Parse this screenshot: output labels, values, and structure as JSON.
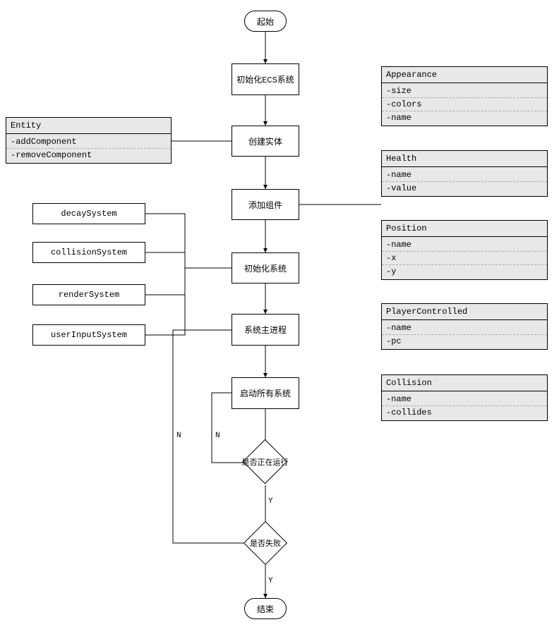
{
  "flow": {
    "start": "起始",
    "init_ecs": "初始化ECS系统",
    "create_entity": "创建实体",
    "add_component": "添加组件",
    "init_system": "初始化系统",
    "main_process": "系统主进程",
    "start_all_systems": "启动所有系统",
    "is_running": "是否正在运行",
    "is_failed": "是否失败",
    "end": "结束"
  },
  "edge_labels": {
    "yes": "Y",
    "no": "N"
  },
  "entity_class": {
    "title": "Entity",
    "attrs": [
      "-addComponent",
      "-removeComponent"
    ]
  },
  "systems": {
    "decay": "decaySystem",
    "collision": "collisionSystem",
    "render": "renderSystem",
    "userInput": "userInputSystem"
  },
  "components": {
    "appearance": {
      "title": "Appearance",
      "attrs": [
        "-size",
        "-colors",
        "-name"
      ]
    },
    "health": {
      "title": "Health",
      "attrs": [
        "-name",
        "-value"
      ]
    },
    "position": {
      "title": "Position",
      "attrs": [
        "-name",
        "-x",
        "-y"
      ]
    },
    "playerControlled": {
      "title": "PlayerControlled",
      "attrs": [
        "-name",
        "-pc"
      ]
    },
    "collision": {
      "title": "Collision",
      "attrs": [
        "-name",
        "-collides"
      ]
    }
  }
}
